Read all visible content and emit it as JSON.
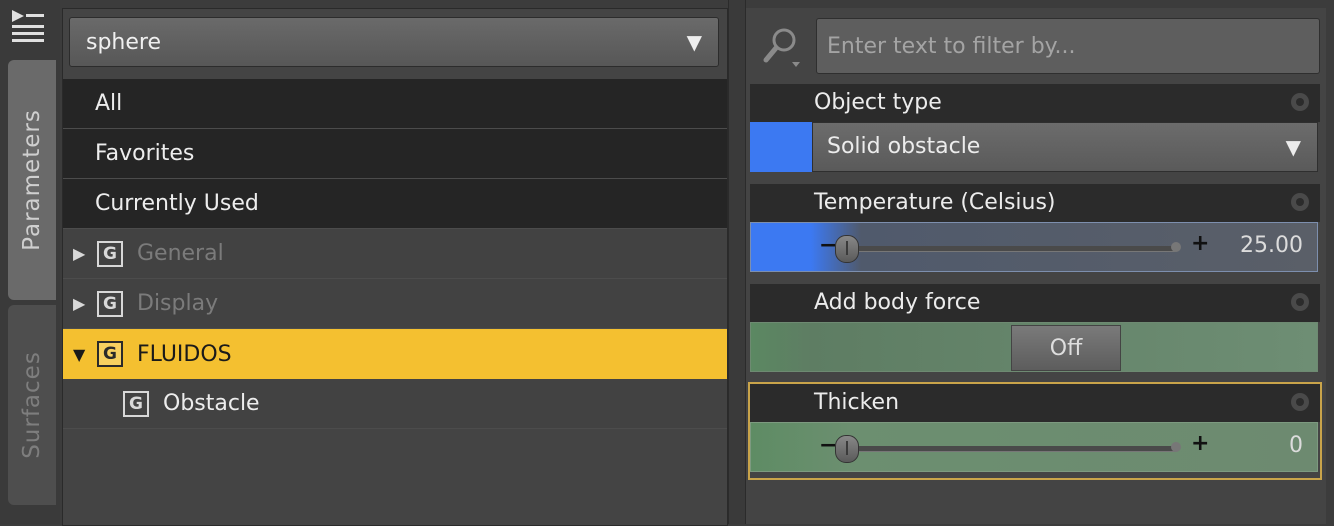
{
  "node_selector": {
    "value": "sphere"
  },
  "vertical_tabs": [
    {
      "label": "Parameters"
    },
    {
      "label": "Surfaces"
    }
  ],
  "groups": {
    "all": "All",
    "favorites": "Favorites",
    "currently_used": "Currently Used",
    "general": "General",
    "display": "Display",
    "fluidos": "FLUIDOS",
    "obstacle": "Obstacle",
    "group_icon_letter": "G"
  },
  "filter": {
    "placeholder": "Enter text to filter by..."
  },
  "properties": {
    "object_type": {
      "label": "Object type",
      "value": "Solid obstacle",
      "swatch_color": "#3c79f2"
    },
    "temperature": {
      "label": "Temperature (Celsius)",
      "value": "25.00",
      "level": 0
    },
    "add_body_force": {
      "label": "Add body force",
      "value": "Off"
    },
    "thicken": {
      "label": "Thicken",
      "value": "0",
      "level": 0
    }
  },
  "colors": {
    "selection": "#f4c030",
    "accent_blue": "#3c79f2",
    "toggle_green": "#6e8e74"
  }
}
